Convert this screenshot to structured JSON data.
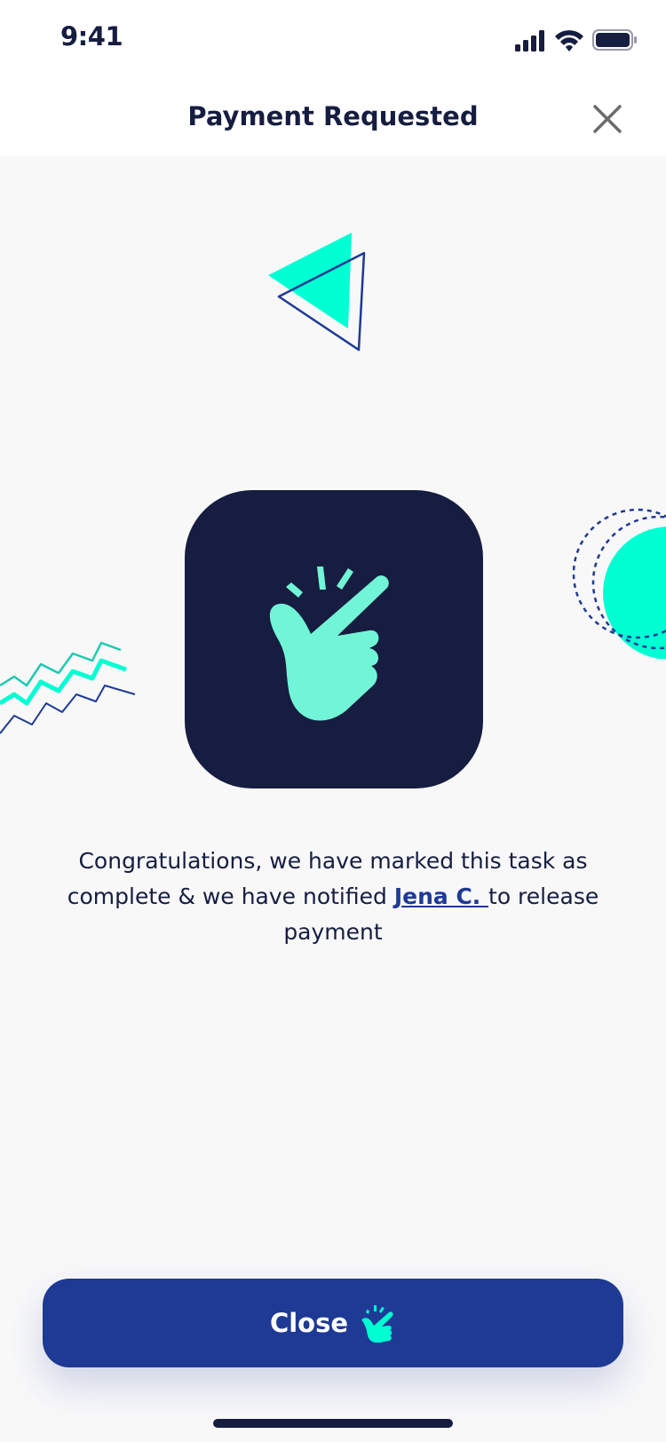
{
  "status_bar": {
    "time": "9:41",
    "icons": [
      "signal-icon",
      "wifi-icon",
      "battery-icon"
    ]
  },
  "nav": {
    "title": "Payment Requested",
    "close_icon": "close-icon"
  },
  "hero_icon": "finger-snap-icon",
  "message": {
    "before": "Congratulations, we have marked this task as complete & we have notified ",
    "link": "Jena C. ",
    "after": "to release payment"
  },
  "button": {
    "label": "Close",
    "icon": "finger-snap-icon"
  },
  "colors": {
    "navy": "#161d40",
    "blue": "#1e3a95",
    "mint": "#00ffd2",
    "mint_soft": "#72f5d6",
    "background": "#f8f8f9"
  }
}
